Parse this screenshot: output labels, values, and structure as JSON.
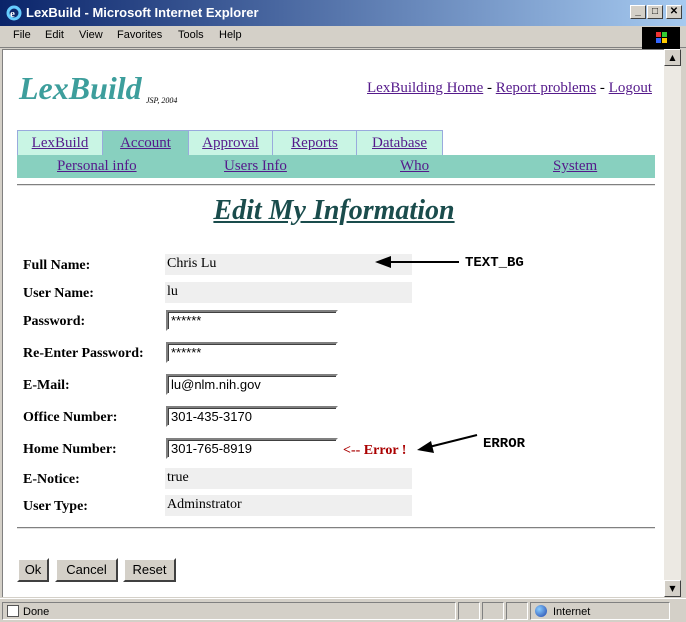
{
  "window": {
    "title": "LexBuild - Microsoft Internet Explorer",
    "min_glyph": "_",
    "max_glyph": "□",
    "close_glyph": "✕"
  },
  "menu": [
    "File",
    "Edit",
    "View",
    "Favorites",
    "Tools",
    "Help"
  ],
  "header": {
    "logo": "LexBuild",
    "logo_sub": "JSP, 2004",
    "links": [
      "LexBuilding Home",
      "Report problems",
      "Logout"
    ],
    "separator": " - "
  },
  "tabs": [
    "LexBuild",
    "Account",
    "Approval",
    "Reports",
    "Database"
  ],
  "active_tab": "Account",
  "subnav": [
    "Personal info",
    "Users Info",
    "Who",
    "System"
  ],
  "page_title": "Edit My Information",
  "form": {
    "full_name_label": "Full Name:",
    "full_name_value": "Chris Lu",
    "user_name_label": "User Name:",
    "user_name_value": "lu",
    "password_label": "Password:",
    "password_value": "******",
    "reenter_label": "Re-Enter Password:",
    "reenter_value": "******",
    "email_label": "E-Mail:",
    "email_value": "lu@nlm.nih.gov",
    "office_label": "Office Number:",
    "office_value": "301-435-3170",
    "home_label": "Home Number:",
    "home_value": "301-765-8919",
    "home_error": "<-- Error !",
    "enotice_label": "E-Notice:",
    "enotice_value": "true",
    "usertype_label": "User Type:",
    "usertype_value": "Adminstrator"
  },
  "annotations": {
    "text_bg": "TEXT_BG",
    "error": "ERROR"
  },
  "buttons": {
    "ok": "Ok",
    "cancel": "Cancel",
    "reset": "Reset"
  },
  "status": {
    "text": "Done",
    "zone": "Internet"
  },
  "colors": {
    "logo": "#3d9e9c",
    "tab_bg": "#c9f5e4",
    "tab_active": "#88d0bf",
    "error": "#aa0000",
    "title": "#1a4c4c"
  }
}
